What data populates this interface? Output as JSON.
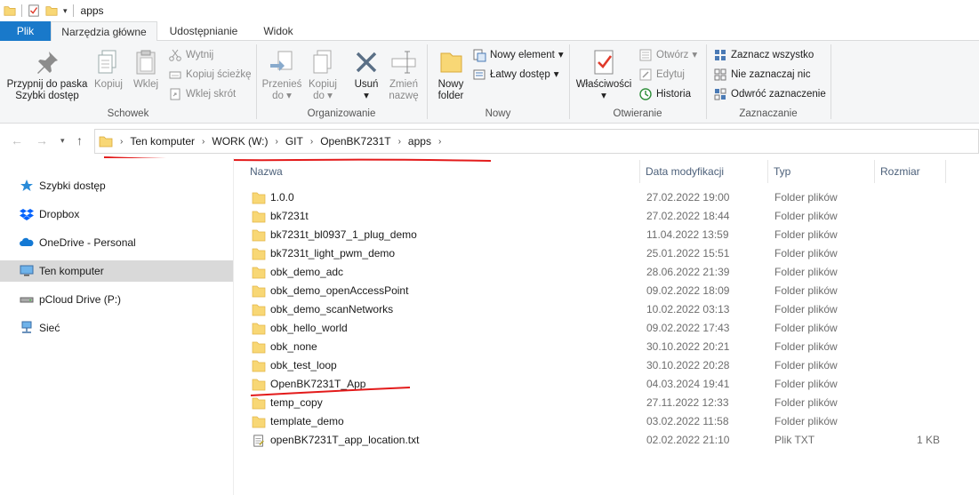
{
  "title_bar": {
    "title": "apps"
  },
  "tabs": [
    {
      "label": "Plik"
    },
    {
      "label": "Narzędzia główne"
    },
    {
      "label": "Udostępnianie"
    },
    {
      "label": "Widok"
    }
  ],
  "ribbon": {
    "groups": {
      "clipboard": "Schowek",
      "organize": "Organizowanie",
      "new": "Nowy",
      "open": "Otwieranie",
      "select": "Zaznaczanie"
    },
    "pin_line1": "Przypnij do paska",
    "pin_line2": "Szybki dostęp",
    "copy": "Kopiuj",
    "paste": "Wklej",
    "cut": "Wytnij",
    "copy_path": "Kopiuj ścieżkę",
    "paste_shortcut": "Wklej skrót",
    "move_to_line1": "Przenieś",
    "move_to_line2": "do",
    "copy_to_line1": "Kopiuj",
    "copy_to_line2": "do",
    "delete": "Usuń",
    "rename_line1": "Zmień",
    "rename_line2": "nazwę",
    "new_folder_line1": "Nowy",
    "new_folder_line2": "folder",
    "new_item": "Nowy element",
    "easy_access": "Łatwy dostęp",
    "properties": "Właściwości",
    "open": "Otwórz",
    "edit": "Edytuj",
    "history": "Historia",
    "select_all": "Zaznacz wszystko",
    "select_none": "Nie zaznaczaj nic",
    "invert_selection": "Odwróć zaznaczenie"
  },
  "breadcrumb": [
    "Ten komputer",
    "WORK (W:)",
    "GIT",
    "OpenBK7231T",
    "apps"
  ],
  "nav_pane": [
    {
      "label": "Szybki dostęp",
      "icon": "star-icon"
    },
    {
      "label": "Dropbox",
      "icon": "dropbox-icon"
    },
    {
      "label": "OneDrive - Personal",
      "icon": "cloud-icon"
    },
    {
      "label": "Ten komputer",
      "icon": "computer-icon"
    },
    {
      "label": "pCloud Drive (P:)",
      "icon": "drive-icon"
    },
    {
      "label": "Sieć",
      "icon": "network-icon"
    }
  ],
  "columns": {
    "name": "Nazwa",
    "date": "Data modyfikacji",
    "type": "Typ",
    "size": "Rozmiar"
  },
  "files": [
    {
      "name": "1.0.0",
      "date": "27.02.2022 19:00",
      "type": "Folder plików",
      "size": ""
    },
    {
      "name": "bk7231t",
      "date": "27.02.2022 18:44",
      "type": "Folder plików",
      "size": ""
    },
    {
      "name": "bk7231t_bl0937_1_plug_demo",
      "date": "11.04.2022 13:59",
      "type": "Folder plików",
      "size": ""
    },
    {
      "name": "bk7231t_light_pwm_demo",
      "date": "25.01.2022 15:51",
      "type": "Folder plików",
      "size": ""
    },
    {
      "name": "obk_demo_adc",
      "date": "28.06.2022 21:39",
      "type": "Folder plików",
      "size": ""
    },
    {
      "name": "obk_demo_openAccessPoint",
      "date": "09.02.2022 18:09",
      "type": "Folder plików",
      "size": ""
    },
    {
      "name": "obk_demo_scanNetworks",
      "date": "10.02.2022 03:13",
      "type": "Folder plików",
      "size": ""
    },
    {
      "name": "obk_hello_world",
      "date": "09.02.2022 17:43",
      "type": "Folder plików",
      "size": ""
    },
    {
      "name": "obk_none",
      "date": "30.10.2022 20:21",
      "type": "Folder plików",
      "size": ""
    },
    {
      "name": "obk_test_loop",
      "date": "30.10.2022 20:28",
      "type": "Folder plików",
      "size": ""
    },
    {
      "name": "OpenBK7231T_App",
      "date": "04.03.2024 19:41",
      "type": "Folder plików",
      "size": ""
    },
    {
      "name": "temp_copy",
      "date": "27.11.2022 12:33",
      "type": "Folder plików",
      "size": ""
    },
    {
      "name": "template_demo",
      "date": "03.02.2022 11:58",
      "type": "Folder plików",
      "size": ""
    },
    {
      "name": "openBK7231T_app_location.txt",
      "date": "02.02.2022 21:10",
      "type": "Plik TXT",
      "size": "1 KB"
    }
  ],
  "colors": {
    "file_tab": "#1979ca",
    "annotation": "#e31b1b",
    "folder": "#f8d775"
  }
}
